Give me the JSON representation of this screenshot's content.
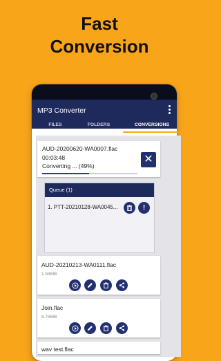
{
  "headline": {
    "line1": "Fast",
    "line2": "Conversion"
  },
  "app": {
    "title": "MP3 Converter",
    "menu_icon": "more-vert-icon"
  },
  "tabs": [
    {
      "label": "FILES",
      "active": false
    },
    {
      "label": "FOLDERS",
      "active": false
    },
    {
      "label": "CONVERSIONS",
      "active": true
    }
  ],
  "conversion": {
    "file_name": "AUD-20200620-WA0007.flac",
    "duration": "00:03:48",
    "status": "Converting ... (49%)",
    "progress": 0.49,
    "cancel_icon": "close-icon"
  },
  "queue": {
    "title": "Queue (1)",
    "items": [
      {
        "label": "1.  PTT-20210128-WA0045..."
      }
    ]
  },
  "files": [
    {
      "name": "AUD-20210213-WA0111.flac",
      "size": "1.94MB"
    },
    {
      "name": "Join.flac",
      "size": "8.75MB"
    },
    {
      "name": "wav test.flac",
      "size": ""
    }
  ],
  "colors": {
    "background": "#f9a51a",
    "primary": "#1f2a5c",
    "button": "#233070",
    "accent": "#f9a51a"
  }
}
